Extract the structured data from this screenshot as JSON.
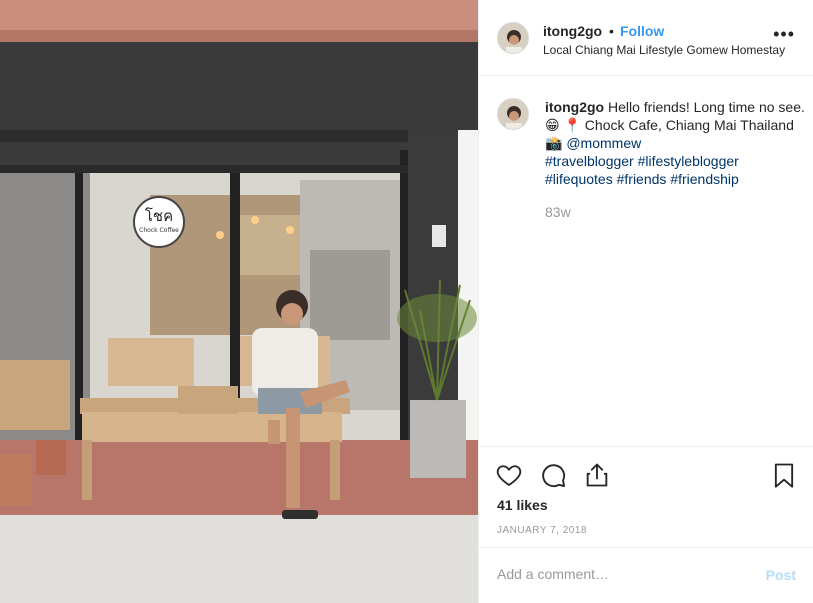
{
  "post": {
    "username": "itong2go",
    "separator": "•",
    "follow_label": "Follow",
    "location": "Local Chiang Mai Lifestyle Gomew Homestay",
    "more_icon": "more-horizontal-icon",
    "caption": {
      "username": "itong2go",
      "text_1": "Hello friends! Long time no see. 😁 📍 Chock Cafe, Chiang Mai Thailand 📸 ",
      "mention": "@mommew",
      "hashtags": [
        "#travelblogger",
        "#lifestyleblogger",
        "#lifequotes",
        "#friends",
        "#friendship"
      ]
    },
    "caption_age": "83w",
    "likes": "41 likes",
    "date": "JANUARY 7, 2018",
    "comment_placeholder": "Add a comment…",
    "post_label": "Post"
  },
  "photo": {
    "cafe_sign": "โชค",
    "cafe_sign_sub": "Chock Coffee"
  },
  "icons": {
    "like": "heart-icon",
    "comment": "comment-icon",
    "share": "share-icon",
    "save": "bookmark-icon"
  },
  "colors": {
    "link": "#3897f0",
    "hashtag": "#003569",
    "muted": "#999999",
    "post_disabled": "#b2dffc"
  }
}
